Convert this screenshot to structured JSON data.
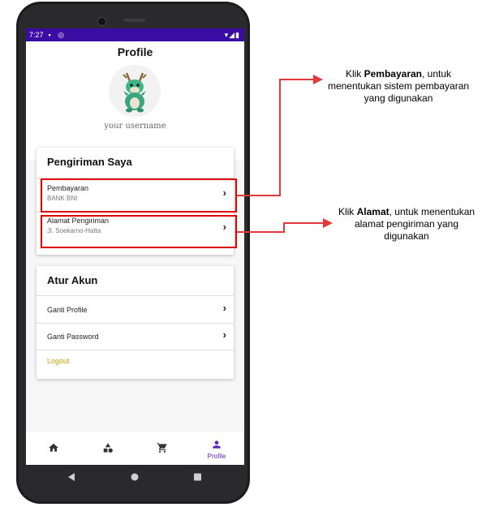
{
  "status_bar": {
    "time": "7:27"
  },
  "header": {
    "title": "Profile"
  },
  "profile": {
    "username": "your username"
  },
  "shipping_card": {
    "title": "Pengiriman Saya",
    "items": [
      {
        "label": "Pembayaran",
        "value": "BANK BNI"
      },
      {
        "label": "Alamat Pengiriman",
        "value": "Jl. Soekarno-Hatta"
      }
    ]
  },
  "account_card": {
    "title": "Atur Akun",
    "items": [
      {
        "label": "Ganti Profile"
      },
      {
        "label": "Ganti Password"
      }
    ],
    "logout_label": "Logout"
  },
  "bottom_nav": {
    "items": [
      {
        "icon": "home-icon"
      },
      {
        "icon": "category-icon"
      },
      {
        "icon": "cart-icon"
      },
      {
        "icon": "person-icon",
        "label": "Profile",
        "active": true
      }
    ]
  },
  "annotations": {
    "payment": {
      "prefix": "Klik ",
      "bold": "Pembayaran",
      "rest": ", untuk menentukan sistem pembayaran yang digunakan"
    },
    "address": {
      "prefix": "Klik ",
      "bold": "Alamat",
      "rest": ", untuk menentukan alamat pengiriman yang digunakan"
    }
  },
  "colors": {
    "status_bar": "#3a0ca3",
    "accent": "#5b21b6",
    "logout": "#c9a200",
    "highlight": "#e00000"
  }
}
